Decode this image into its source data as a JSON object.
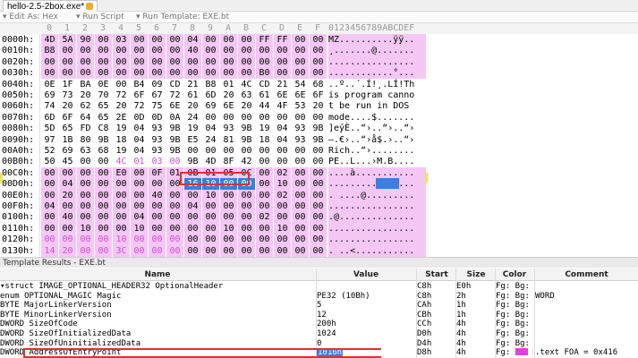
{
  "tab": {
    "title": "hello-2.5-2box.exe*"
  },
  "toolbar": {
    "edit_as": "Edit As: Hex",
    "run_script": "Run Script",
    "run_template": "Run Template: EXE.bt"
  },
  "hex_header": {
    "columns": [
      "0",
      "1",
      "2",
      "3",
      "4",
      "5",
      "6",
      "7",
      "8",
      "9",
      "A",
      "B",
      "C",
      "D",
      "E",
      "F"
    ],
    "ascii": "0123456789ABCDEF"
  },
  "hex_rows": [
    {
      "addr": "0000h:",
      "bytes": [
        "4D",
        "5A",
        "90",
        "00",
        "03",
        "00",
        "00",
        "00",
        "04",
        "00",
        "00",
        "00",
        "FF",
        "FF",
        "00",
        "00"
      ],
      "ascii": "MZ..........ÿÿ..",
      "pink": true
    },
    {
      "addr": "0010h:",
      "bytes": [
        "B8",
        "00",
        "00",
        "00",
        "00",
        "00",
        "00",
        "00",
        "40",
        "00",
        "00",
        "00",
        "00",
        "00",
        "00",
        "00"
      ],
      "ascii": "¸.......@.......",
      "pink": true
    },
    {
      "addr": "0020h:",
      "bytes": [
        "00",
        "00",
        "00",
        "00",
        "00",
        "00",
        "00",
        "00",
        "00",
        "00",
        "00",
        "00",
        "00",
        "00",
        "00",
        "00"
      ],
      "ascii": "................",
      "pink": true
    },
    {
      "addr": "0030h:",
      "bytes": [
        "00",
        "00",
        "00",
        "00",
        "00",
        "00",
        "00",
        "00",
        "00",
        "00",
        "00",
        "00",
        "B0",
        "00",
        "00",
        "00"
      ],
      "ascii": "............°...",
      "pink": true
    },
    {
      "addr": "0040h:",
      "bytes": [
        "0E",
        "1F",
        "BA",
        "0E",
        "00",
        "B4",
        "09",
        "CD",
        "21",
        "B8",
        "01",
        "4C",
        "CD",
        "21",
        "54",
        "68"
      ],
      "ascii": "..º..´.Í!¸.LÍ!Th",
      "pink": false
    },
    {
      "addr": "0050h:",
      "bytes": [
        "69",
        "73",
        "20",
        "70",
        "72",
        "6F",
        "67",
        "72",
        "61",
        "6D",
        "20",
        "63",
        "61",
        "6E",
        "6E",
        "6F"
      ],
      "ascii": "is program canno",
      "pink": false
    },
    {
      "addr": "0060h:",
      "bytes": [
        "74",
        "20",
        "62",
        "65",
        "20",
        "72",
        "75",
        "6E",
        "20",
        "69",
        "6E",
        "20",
        "44",
        "4F",
        "53",
        "20"
      ],
      "ascii": "t be run in DOS ",
      "pink": false
    },
    {
      "addr": "0070h:",
      "bytes": [
        "6D",
        "6F",
        "64",
        "65",
        "2E",
        "0D",
        "0D",
        "0A",
        "24",
        "00",
        "00",
        "00",
        "00",
        "00",
        "00",
        "00"
      ],
      "ascii": "mode....$.......",
      "pink": false
    },
    {
      "addr": "0080h:",
      "bytes": [
        "5D",
        "65",
        "FD",
        "C8",
        "19",
        "04",
        "93",
        "9B",
        "19",
        "04",
        "93",
        "9B",
        "19",
        "04",
        "93",
        "9B"
      ],
      "ascii": "]eýÈ..“›..“›..“›",
      "pink": false
    },
    {
      "addr": "0090h:",
      "bytes": [
        "97",
        "1B",
        "80",
        "9B",
        "18",
        "04",
        "93",
        "9B",
        "E5",
        "24",
        "81",
        "9B",
        "18",
        "04",
        "93",
        "9B"
      ],
      "ascii": "—.€›..“›å$.›..“›",
      "pink": false
    },
    {
      "addr": "00A0h:",
      "bytes": [
        "52",
        "69",
        "63",
        "68",
        "19",
        "04",
        "93",
        "9B",
        "00",
        "00",
        "00",
        "00",
        "00",
        "00",
        "00",
        "00"
      ],
      "ascii": "Rich..“›........",
      "pink": false
    },
    {
      "addr": "00B0h:",
      "bytes": [
        "50",
        "45",
        "00",
        "00",
        "4C",
        "01",
        "03",
        "00",
        "9B",
        "4D",
        "8F",
        "42",
        "00",
        "00",
        "00",
        "00"
      ],
      "ascii": "PE..L...›M.B....",
      "pink": false
    },
    {
      "addr": "00C0h:",
      "bytes": [
        "00",
        "00",
        "00",
        "00",
        "E0",
        "00",
        "0F",
        "01",
        "0B",
        "01",
        "05",
        "0C",
        "00",
        "02",
        "00",
        "00"
      ],
      "ascii": "....à...........",
      "pink": true
    },
    {
      "addr": "00D0h:",
      "bytes": [
        "00",
        "04",
        "00",
        "00",
        "00",
        "00",
        "00",
        "00",
        "16",
        "10",
        "00",
        "00",
        "00",
        "10",
        "00",
        "00"
      ],
      "ascii": "................",
      "pink": true
    },
    {
      "addr": "00E0h:",
      "bytes": [
        "00",
        "20",
        "00",
        "00",
        "00",
        "00",
        "40",
        "00",
        "00",
        "10",
        "00",
        "00",
        "00",
        "02",
        "00",
        "00"
      ],
      "ascii": ". ....@.........",
      "pink": true
    },
    {
      "addr": "00F0h:",
      "bytes": [
        "04",
        "00",
        "00",
        "00",
        "00",
        "00",
        "00",
        "00",
        "04",
        "00",
        "00",
        "00",
        "00",
        "00",
        "00",
        "00"
      ],
      "ascii": "................",
      "pink": true
    },
    {
      "addr": "0100h:",
      "bytes": [
        "00",
        "40",
        "00",
        "00",
        "00",
        "04",
        "00",
        "00",
        "00",
        "00",
        "00",
        "00",
        "02",
        "00",
        "00",
        "00"
      ],
      "ascii": ".@..............",
      "pink": true
    },
    {
      "addr": "0110h:",
      "bytes": [
        "00",
        "00",
        "10",
        "00",
        "00",
        "10",
        "00",
        "00",
        "00",
        "00",
        "10",
        "00",
        "00",
        "10",
        "00",
        "00"
      ],
      "ascii": "................",
      "pink": true
    },
    {
      "addr": "0120h:",
      "bytes": [
        "00",
        "00",
        "00",
        "00",
        "10",
        "00",
        "00",
        "00",
        "00",
        "00",
        "00",
        "00",
        "00",
        "00",
        "00",
        "00"
      ],
      "ascii": "................",
      "pink": true
    },
    {
      "addr": "0130h:",
      "bytes": [
        "14",
        "20",
        "00",
        "00",
        "3C",
        "00",
        "00",
        "00",
        "00",
        "00",
        "00",
        "00",
        "00",
        "00",
        "00",
        "00"
      ],
      "ascii": ". ..<...........",
      "pink": true
    }
  ],
  "template_bar": "Template Results - EXE.bt",
  "table": {
    "headers": {
      "name": "Name",
      "value": "Value",
      "start": "Start",
      "size": "Size",
      "color": "Color",
      "comment": "Comment"
    },
    "rows": [
      {
        "name": "▾struct IMAGE_OPTIONAL_HEADER32 OptionalHeader",
        "value": "",
        "start": "C8h",
        "size": "E0h",
        "color": "Fg:   Bg:",
        "comment": ""
      },
      {
        "name": "      enum OPTIONAL_MAGIC Magic",
        "value": "PE32 (10Bh)",
        "start": "C8h",
        "size": "2h",
        "color": "Fg:   Bg:",
        "comment": "WORD"
      },
      {
        "name": "      BYTE MajorLinkerVersion",
        "value": "5",
        "start": "CAh",
        "size": "1h",
        "color": "Fg:   Bg:",
        "comment": ""
      },
      {
        "name": "      BYTE MinorLinkerVersion",
        "value": "12",
        "start": "CBh",
        "size": "1h",
        "color": "Fg:   Bg:",
        "comment": ""
      },
      {
        "name": "      DWORD SizeOfCode",
        "value": "200h",
        "start": "CCh",
        "size": "4h",
        "color": "Fg:   Bg:",
        "comment": ""
      },
      {
        "name": "      DWORD SizeOfInitializedData",
        "value": "1024",
        "start": "D0h",
        "size": "4h",
        "color": "Fg:   Bg:",
        "comment": ""
      },
      {
        "name": "      DWORD SizeOfUninitializedData",
        "value": "0",
        "start": "D4h",
        "size": "4h",
        "color": "Fg:   Bg:",
        "comment": ""
      },
      {
        "name": "      DWORD AddressOfEntryPoint",
        "value": "1016h",
        "start": "D8h",
        "size": "4h",
        "color": "Fg:   Bg:",
        "comment": ".text FOA = 0x416"
      }
    ]
  },
  "colors": {
    "pink": "#f5c7f5",
    "selection": "#3b7de0",
    "highlight_box": "#e03030",
    "swatch": "#e040e0"
  }
}
